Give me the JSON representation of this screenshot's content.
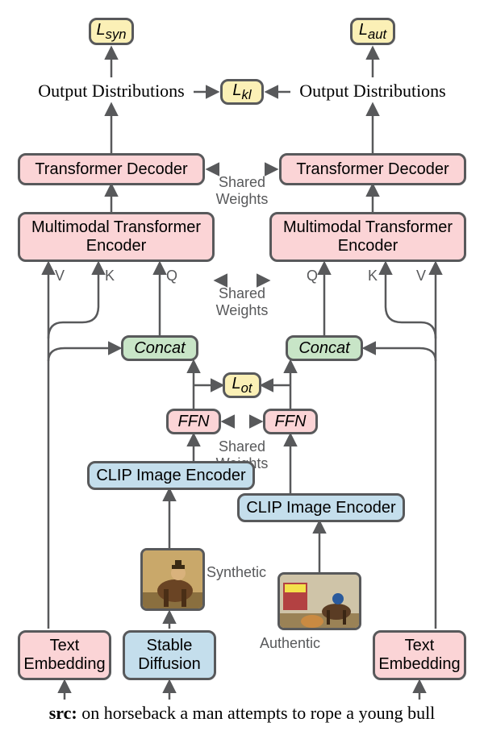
{
  "losses": {
    "syn": "L",
    "syn_sub": "syn",
    "aut": "L",
    "aut_sub": "aut",
    "kl": "L",
    "kl_sub": "kl",
    "ot": "L",
    "ot_sub": "ot"
  },
  "labels": {
    "output_left": "Output Distributions",
    "output_right": "Output Distributions",
    "shared_weights": "Shared Weights",
    "synthetic": "Synthetic",
    "authentic": "Authentic"
  },
  "blocks": {
    "decoder_left": "Transformer Decoder",
    "decoder_right": "Transformer Decoder",
    "encoder_left": "Multimodal Transformer Encoder",
    "encoder_right": "Multimodal Transformer Encoder",
    "concat_left": "Concat",
    "concat_right": "Concat",
    "ffn_left": "FFN",
    "ffn_right": "FFN",
    "clip_left": "CLIP Image Encoder",
    "clip_right": "CLIP Image Encoder",
    "text_emb_left": "Text Embedding",
    "text_emb_right": "Text Embedding",
    "stable_diffusion": "Stable Diffusion"
  },
  "qkv": {
    "v_left": "V",
    "k_left": "K",
    "q_left": "Q",
    "q_right": "Q",
    "k_right": "K",
    "v_right": "V"
  },
  "caption": {
    "prefix": "src:",
    "text": " on horseback a man attempts to rope a young bull"
  }
}
